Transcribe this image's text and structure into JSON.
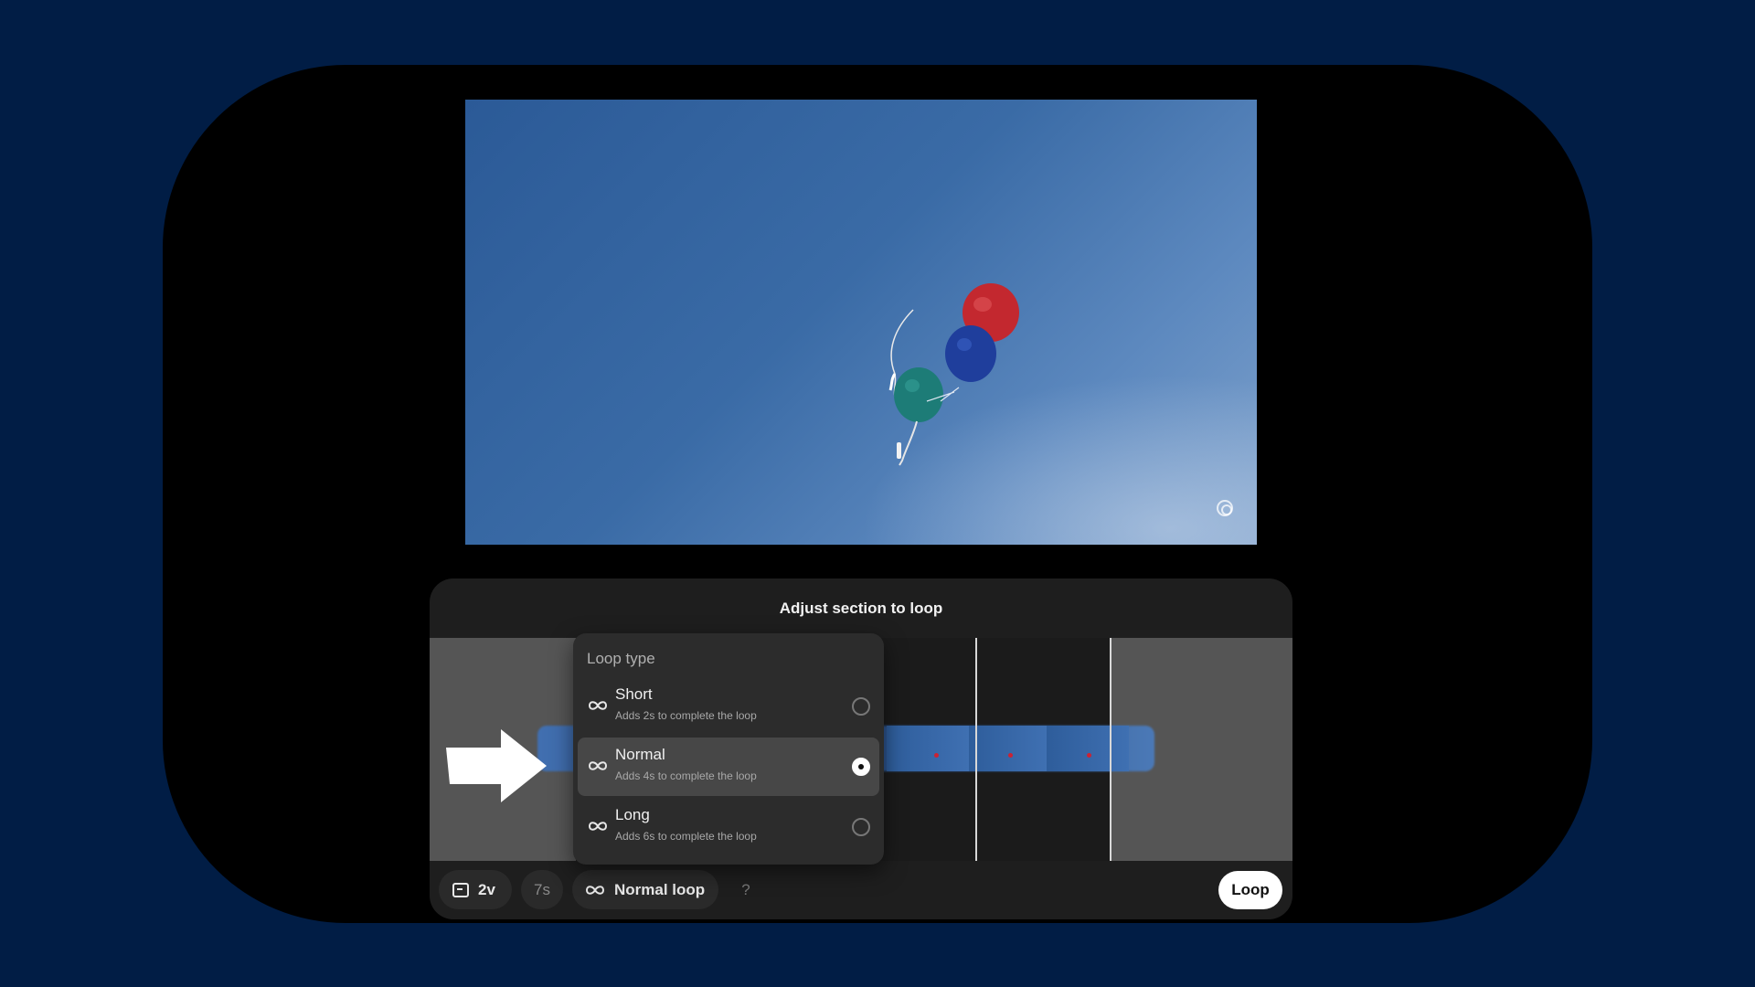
{
  "panel": {
    "title": "Adjust section to loop"
  },
  "loop_menu": {
    "title": "Loop type",
    "items": [
      {
        "label": "Short",
        "sub": "Adds 2s to complete the loop",
        "selected": false,
        "icon": "infinity-icon"
      },
      {
        "label": "Normal",
        "sub": "Adds 4s to complete the loop",
        "selected": true,
        "icon": "infinity-icon"
      },
      {
        "label": "Long",
        "sub": "Adds 6s to complete the loop",
        "selected": false,
        "icon": "infinity-icon"
      }
    ]
  },
  "toolbar": {
    "aspect_label": "2v",
    "duration_label": "7s",
    "loop_type_label": "Normal loop",
    "help_label": "?",
    "loop_button_label": "Loop"
  },
  "colors": {
    "background": "#011d45",
    "device": "#000000",
    "panel": "#1e1e1e",
    "menu": "#2c2c2c",
    "accent": "#ffffff"
  }
}
